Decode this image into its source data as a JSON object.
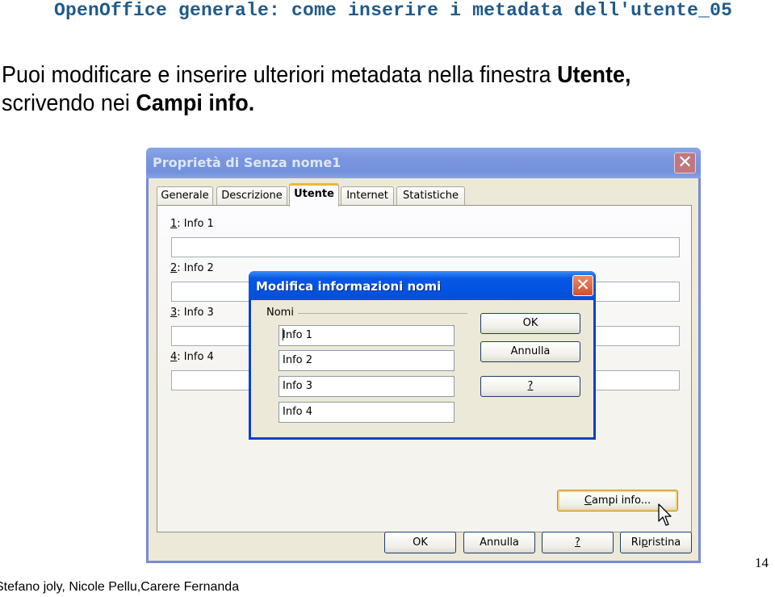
{
  "slide": {
    "title": "OpenOffice generale: come inserire i metadata dell'utente_05",
    "body_line1_text": "Puoi modificare e inserire ulteriori metadata nella finestra ",
    "body_line1_bold": "Utente,",
    "body_line2_text": "scrivendo nei ",
    "body_line2_bold": "Campi info.",
    "footer_authors": "Stefano joly, Nicole Pellu,Carere Fernanda",
    "page_number": "14"
  },
  "properties_dialog": {
    "title": "Proprietà di Senza nome1",
    "close_icon": "close-x",
    "tabs": [
      {
        "label": "Generale",
        "active": false
      },
      {
        "label": "Descrizione",
        "active": false
      },
      {
        "label": "Utente",
        "active": true
      },
      {
        "label": "Internet",
        "active": false
      },
      {
        "label": "Statistiche",
        "active": false
      }
    ],
    "fields": [
      {
        "accel": "1",
        "label": ": Info 1",
        "value": ""
      },
      {
        "accel": "2",
        "label": ": Info 2",
        "value": ""
      },
      {
        "accel": "3",
        "label": ": Info 3",
        "value": ""
      },
      {
        "accel": "4",
        "label": ": Info 4",
        "value": ""
      }
    ],
    "campi_info_button": {
      "accel": "C",
      "rest": "ampi info..."
    },
    "buttons": {
      "ok": "OK",
      "annulla": "Annulla",
      "help": "?",
      "ripristina_pre": "Ri",
      "ripristina_accel": "p",
      "ripristina_post": "ristina"
    }
  },
  "modal_dialog": {
    "title": "Modifica informazioni nomi",
    "close_icon": "close-x",
    "group_label": "Nomi",
    "inputs": [
      "Info 1",
      "Info 2",
      "Info 3",
      "Info 4"
    ],
    "buttons": {
      "ok": "OK",
      "annulla": "Annulla",
      "help": "?"
    }
  },
  "colors": {
    "slide_title": "#1f5a8a",
    "modal_titlebar": "#0053e1",
    "inactive_titlebar": "#7a95e0",
    "focus_button_border": "#f6cf7a"
  }
}
